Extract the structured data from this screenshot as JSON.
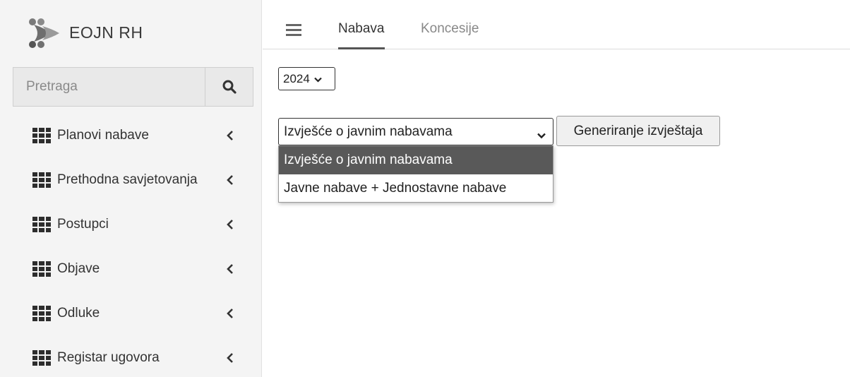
{
  "brand": {
    "name": "EOJN RH",
    "logo_icon": "eojn-logo-icon"
  },
  "search": {
    "placeholder": "Pretraga",
    "value": "",
    "icon": "search-icon"
  },
  "sidebar": {
    "items": [
      {
        "label": "Planovi nabave",
        "icon": "grid-icon",
        "chevron": "chevron-left-icon"
      },
      {
        "label": "Prethodna savjetovanja",
        "icon": "grid-icon",
        "chevron": "chevron-left-icon"
      },
      {
        "label": "Postupci",
        "icon": "grid-icon",
        "chevron": "chevron-left-icon"
      },
      {
        "label": "Objave",
        "icon": "grid-icon",
        "chevron": "chevron-left-icon"
      },
      {
        "label": "Odluke",
        "icon": "grid-icon",
        "chevron": "chevron-left-icon"
      },
      {
        "label": "Registar ugovora",
        "icon": "grid-icon",
        "chevron": "chevron-left-icon"
      }
    ]
  },
  "header": {
    "menu_icon": "hamburger-icon",
    "tabs": [
      {
        "label": "Nabava",
        "active": true
      },
      {
        "label": "Koncesije",
        "active": false
      }
    ]
  },
  "main": {
    "year_select": {
      "value": "2024"
    },
    "report_select": {
      "value": "Izvješće o javnim nabavama",
      "options": [
        "Izvješće o javnim nabavama",
        "Javne nabave + Jednostavne nabave"
      ],
      "highlighted_index": 0,
      "expanded": true
    },
    "generate_button": "Generiranje izvještaja"
  },
  "colors": {
    "sidebar_bg": "#f4f4f4",
    "highlight_option_bg": "#595959",
    "active_tab_underline": "#555555"
  }
}
